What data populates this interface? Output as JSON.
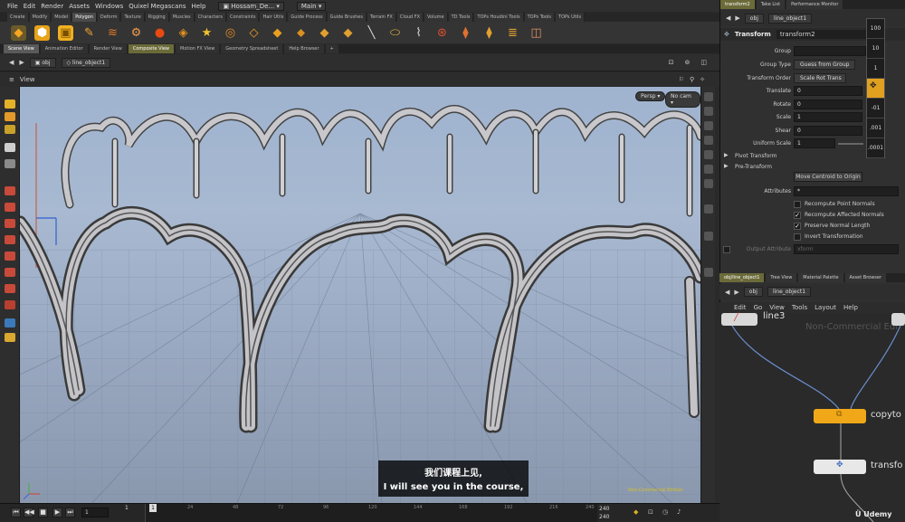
{
  "menubar": {
    "items": [
      "File",
      "Edit",
      "Render",
      "Assets",
      "Windows",
      "Quixel Megascans",
      "Help"
    ],
    "desktop": "Hossam_De...",
    "main": "Main"
  },
  "shelf_tabs": [
    "Create",
    "Modify",
    "Model",
    "Polygon",
    "Deform",
    "Texture",
    "Rigging",
    "Muscles",
    "Characters",
    "Constraints",
    "Hair Utils",
    "Guide Process",
    "Guide Brushes",
    "Terrain FX",
    "Cloud FX",
    "Volume",
    "TD Tools",
    "TOPs Houdini Tools",
    "TOPs Tools",
    "TOPs Utils"
  ],
  "shelf_tabs_active": 3,
  "pane_tabs": [
    "Scene View",
    "Animation Editor",
    "Render View",
    "Composite View",
    "Motion FX View",
    "Geometry Spreadsheet",
    "Help Browser"
  ],
  "path": {
    "root": "obj",
    "node": "line_object1"
  },
  "viewer": {
    "title": "View",
    "persp": "Persp",
    "cam": "No cam"
  },
  "subtitle": {
    "zh": "我们课程上见,",
    "en": "I will see you in the course,"
  },
  "timeline": {
    "frame": "1",
    "start": "1",
    "end": "240",
    "end2": "240",
    "ticks": [
      "1",
      "24",
      "48",
      "72",
      "96",
      "120",
      "144",
      "168",
      "192",
      "216",
      "240"
    ],
    "watermark": "Non-Commercial Edition"
  },
  "right_panel": {
    "tabs": [
      "transform2",
      "Take List",
      "Performance Monitor"
    ],
    "path": {
      "root": "obj",
      "node": "line_object1"
    },
    "node_type": "Transform",
    "node_name": "transform2",
    "params": {
      "group_label": "Group",
      "group_type_label": "Group Type",
      "group_type_value": "Guess from Group",
      "xform_order_label": "Transform Order",
      "xform_order_value": "Scale Rot Trans",
      "translate_label": "Translate",
      "translate_value": "0",
      "rotate_label": "Rotate",
      "rotate_value": "0",
      "scale_label": "Scale",
      "scale_value": "1",
      "shear_label": "Shear",
      "shear_value": "0",
      "uniform_scale_label": "Uniform Scale",
      "uniform_scale_value": "1",
      "pivot_transform": "Pivot Transform",
      "pre_transform": "Pre-Transform",
      "move_centroid": "Move Centroid to Origin",
      "attributes_label": "Attributes",
      "attributes_value": "*",
      "recompute_point_normals": "Recompute Point Normals",
      "recompute_affected_normals": "Recompute Affected Normals",
      "preserve_normal_length": "Preserve Normal Length",
      "invert_transformation": "Invert Transformation",
      "output_attribute_label": "Output Attribute",
      "output_attribute_value": "xform"
    },
    "ladder": [
      "100",
      "10",
      "1",
      "",
      "-01",
      ".001",
      ".0001"
    ]
  },
  "network": {
    "tabs": [
      "obj/line_object1",
      "Tree View",
      "Material Palette",
      "Asset Browser"
    ],
    "path": {
      "root": "obj",
      "node": "line_object1"
    },
    "menu": [
      "Edit",
      "Go",
      "View",
      "Tools",
      "Layout",
      "Help"
    ],
    "watermark": "Non-Commercial Edi",
    "nodes": [
      {
        "name": "line3",
        "color": "#d8d8d8"
      },
      {
        "name": "copyto",
        "color": "#f0a818"
      },
      {
        "name": "transfo",
        "color": "#e8e8e8"
      }
    ],
    "brand": "Udemy"
  }
}
